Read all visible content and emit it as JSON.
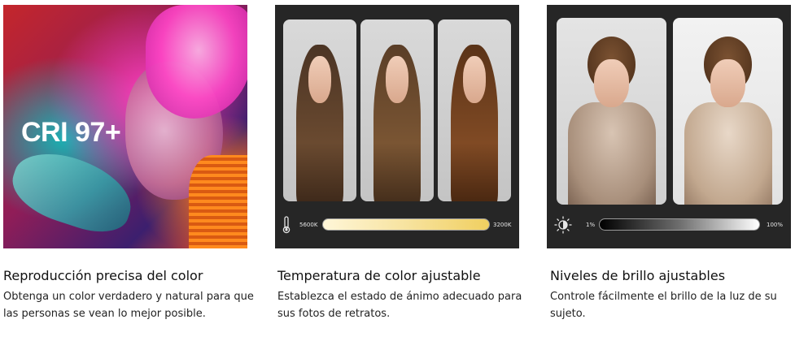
{
  "cards": [
    {
      "badge": "CRI 97+",
      "title": "Reproducción precisa del color",
      "desc": "Obtenga un color verdadero y natural para que las personas se vean lo mejor posible."
    },
    {
      "slider_min_label": "5600K",
      "slider_max_label": "3200K",
      "icon": "thermometer-icon",
      "title": "Temperatura de color ajustable",
      "desc": "Establezca el estado de ánimo adecuado para sus fotos de retratos."
    },
    {
      "slider_min_label": "1%",
      "slider_max_label": "100%",
      "icon": "brightness-icon",
      "title": "Niveles de brillo ajustables",
      "desc": "Controle fácilmente el brillo de la luz de su sujeto."
    }
  ],
  "colors": {
    "panel_bg": "#262626",
    "temperature_gradient": [
      "#fff6d8",
      "#f0cf60"
    ],
    "brightness_gradient": [
      "#000000",
      "#ffffff"
    ]
  }
}
